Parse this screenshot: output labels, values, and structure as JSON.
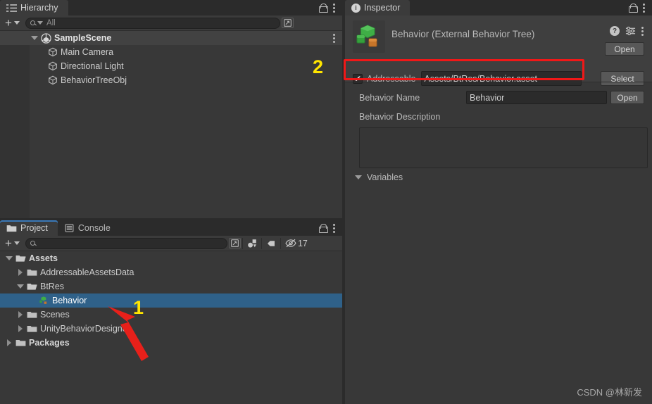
{
  "hierarchy": {
    "tab_label": "Hierarchy",
    "tab_icon": "hierarchy-list-icon",
    "lock_icon": "lock-icon",
    "menu_icon": "kebab-menu-icon",
    "toolbar": {
      "add_label": "+",
      "add_icon": "plus-icon",
      "dropdown_icon": "chevron-down-icon",
      "search_placeholder": "All",
      "search_value": "",
      "search_icon": "search-icon",
      "save_search_icon": "save-search-icon"
    },
    "rows": [
      {
        "label": "SampleScene",
        "icon": "unity-scene-icon",
        "indent": 1,
        "expanded": true,
        "kind": "scene",
        "has_menu": true
      },
      {
        "label": "Main Camera",
        "icon": "gameobject-cube-icon",
        "indent": 2,
        "kind": "gameobject"
      },
      {
        "label": "Directional Light",
        "icon": "gameobject-cube-icon",
        "indent": 2,
        "kind": "gameobject"
      },
      {
        "label": "BehaviorTreeObj",
        "icon": "gameobject-cube-icon",
        "indent": 2,
        "kind": "gameobject"
      }
    ]
  },
  "project": {
    "tabs": [
      {
        "label": "Project",
        "icon": "folder-icon",
        "active": true
      },
      {
        "label": "Console",
        "icon": "console-lines-icon",
        "active": false
      }
    ],
    "lock_icon": "lock-icon",
    "menu_icon": "kebab-menu-icon",
    "toolbar": {
      "add_label": "+",
      "add_icon": "plus-icon",
      "dropdown_icon": "chevron-down-icon",
      "search_placeholder": "",
      "search_value": "",
      "search_icon": "search-icon",
      "save_search_icon": "save-search-icon",
      "filter_type_icon": "filter-by-type-icon",
      "filter_label_icon": "filter-by-label-icon",
      "hidden_count_icon": "eye-off-icon",
      "hidden_count": "17"
    },
    "rows": [
      {
        "label": "Assets",
        "icon": "folder-open-icon",
        "indent": 0,
        "expanded": true,
        "bold": true
      },
      {
        "label": "AddressableAssetsData",
        "icon": "folder-icon",
        "indent": 1,
        "expanded": false
      },
      {
        "label": "BtRes",
        "icon": "folder-open-icon",
        "indent": 1,
        "expanded": true
      },
      {
        "label": "Behavior",
        "icon": "behavior-tree-asset-icon",
        "indent": 2,
        "selected": true,
        "leaf": true
      },
      {
        "label": "Scenes",
        "icon": "folder-icon",
        "indent": 1,
        "expanded": false
      },
      {
        "label": "UnityBehaviorDesigner",
        "icon": "folder-icon",
        "indent": 1,
        "expanded": false
      },
      {
        "label": "Packages",
        "icon": "folder-icon",
        "indent": 0,
        "expanded": false,
        "bold": true
      }
    ]
  },
  "inspector": {
    "tab_label": "Inspector",
    "tab_icon": "info-circle-icon",
    "lock_icon": "lock-icon",
    "menu_icon": "kebab-menu-icon",
    "asset_icon": "behavior-tree-asset-icon",
    "title": "Behavior (External Behavior Tree)",
    "help_icon": "help-circle-icon",
    "preset_icon": "preset-settings-icon",
    "header_menu_icon": "kebab-menu-icon",
    "open_button_top": "Open",
    "addressable": {
      "checked": true,
      "check_glyph": "✔",
      "label": "Addressable",
      "address_value": "Assets/BtRes/Behavior.asset",
      "select_button": "Select"
    },
    "behavior_name": {
      "label": "Behavior Name",
      "value": "Behavior",
      "open_button": "Open"
    },
    "behavior_description": {
      "label": "Behavior Description",
      "value": ""
    },
    "variables": {
      "label": "Variables",
      "expanded": true,
      "foldout_icon": "triangle-down-icon"
    }
  },
  "annotations": {
    "marker_one": "1",
    "marker_two": "2",
    "arrow_icon": "red-arrow-icon",
    "redbox_icon": "red-highlight-box",
    "marker_color": "#ffe500",
    "highlight_color": "#f01818"
  },
  "watermark": {
    "text": "CSDN @林新发"
  }
}
